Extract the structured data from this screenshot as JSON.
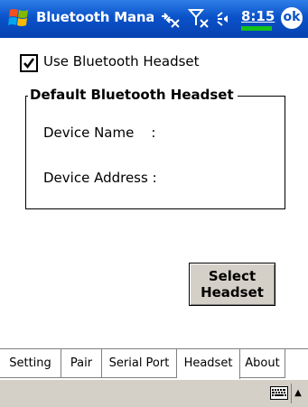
{
  "titlebar": {
    "title": "Bluetooth Mana",
    "clock": "8:15",
    "ok_label": "ok",
    "icons": [
      "windows-start-icon",
      "connectivity-icon",
      "signal-off-icon",
      "speaker-icon"
    ]
  },
  "main": {
    "use_headset_label": "Use Bluetooth Headset",
    "use_headset_checked": true,
    "group_title": "Default Bluetooth Headset",
    "device_name_label": "Device Name    :",
    "device_address_label": "Device Address :",
    "select_button": [
      "Select",
      "Headset"
    ]
  },
  "tabs": [
    {
      "label": "Setting",
      "active": false
    },
    {
      "label": "Pair",
      "active": false
    },
    {
      "label": "Serial Port",
      "active": false
    },
    {
      "label": "Headset",
      "active": true
    },
    {
      "label": "About",
      "active": false
    }
  ],
  "menubar": {
    "icons": [
      "keyboard-icon",
      "input-menu-arrow-icon"
    ],
    "arrow_glyph": "▲"
  },
  "colors": {
    "titlebar": "#0a52c9",
    "menubar": "#d4d0c8",
    "battery": "#13c219"
  }
}
